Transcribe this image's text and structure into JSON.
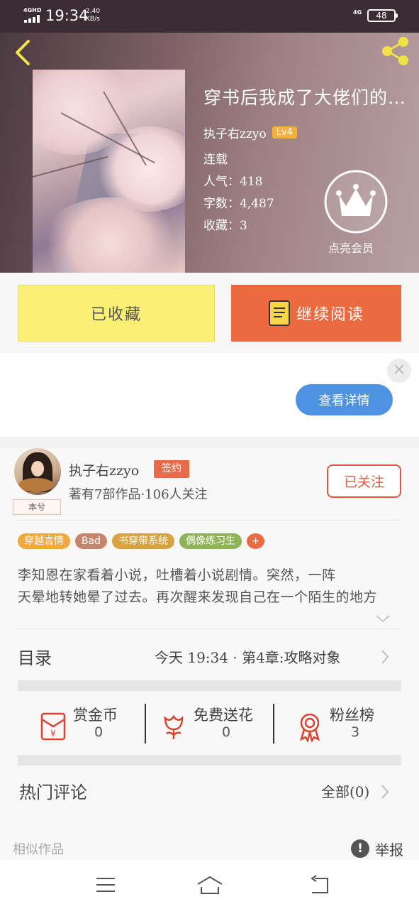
{
  "status_bar": {
    "signal": "4GHD",
    "time": "19:34",
    "speed_value": "2.40",
    "speed_unit": "KB/s",
    "network": "4G",
    "battery": "48"
  },
  "book": {
    "title": "穿书后我成了大佬们的白月光",
    "author": "执子右zzyo",
    "level": "Lv4",
    "status": "连载",
    "popularity": "人气：418",
    "word_count": "字数：4,487",
    "favorites": "收藏：3",
    "vip_label": "点亮会员"
  },
  "actions": {
    "favorited_label": "已收藏",
    "continue_label": "继续阅读"
  },
  "ad": {
    "close_glyph": "×",
    "details_label": "查看详情"
  },
  "author": {
    "avatar_tag": "本兮",
    "name": "执子右zzyo",
    "sign_badge": "签约",
    "stats": "著有7部作品·106人关注",
    "follow_label": "已关注"
  },
  "tags": [
    {
      "label": "穿越言情",
      "color": "#f1a93a"
    },
    {
      "label": "Bad",
      "color": "#c7856c"
    },
    {
      "label": "书穿带系统",
      "color": "#d7a23f"
    },
    {
      "label": "偶像练习生",
      "color": "#8fb356"
    },
    {
      "label": "+",
      "color": "#ec6a40"
    }
  ],
  "synopsis": {
    "line1": "李知恩在家看着小说，吐槽着小说剧情。突然，一阵",
    "line2": "天晕地转她晕了过去。再次醒来发现自己在一个陌生的地方"
  },
  "toc": {
    "label": "目录",
    "latest": "今天 19:34 · 第4章:攻略对象"
  },
  "stats": [
    {
      "label": "赏金币",
      "value": "0",
      "icon": "red-envelope-icon"
    },
    {
      "label": "免费送花",
      "value": "0",
      "icon": "flower-icon"
    },
    {
      "label": "粉丝榜",
      "value": "3",
      "icon": "medal-icon"
    }
  ],
  "comments": {
    "label": "热门评论",
    "all_label": "全部(0)"
  },
  "footer": {
    "similar_label": "相似作品",
    "report_glyph": "!",
    "report_label": "举报"
  },
  "colors": {
    "accent_orange": "#eb6a3f",
    "fav_yellow": "#fbf075",
    "ad_blue": "#4e93e3",
    "level_badge": "#f3b13c",
    "back_arrow": "#f2e24a"
  }
}
